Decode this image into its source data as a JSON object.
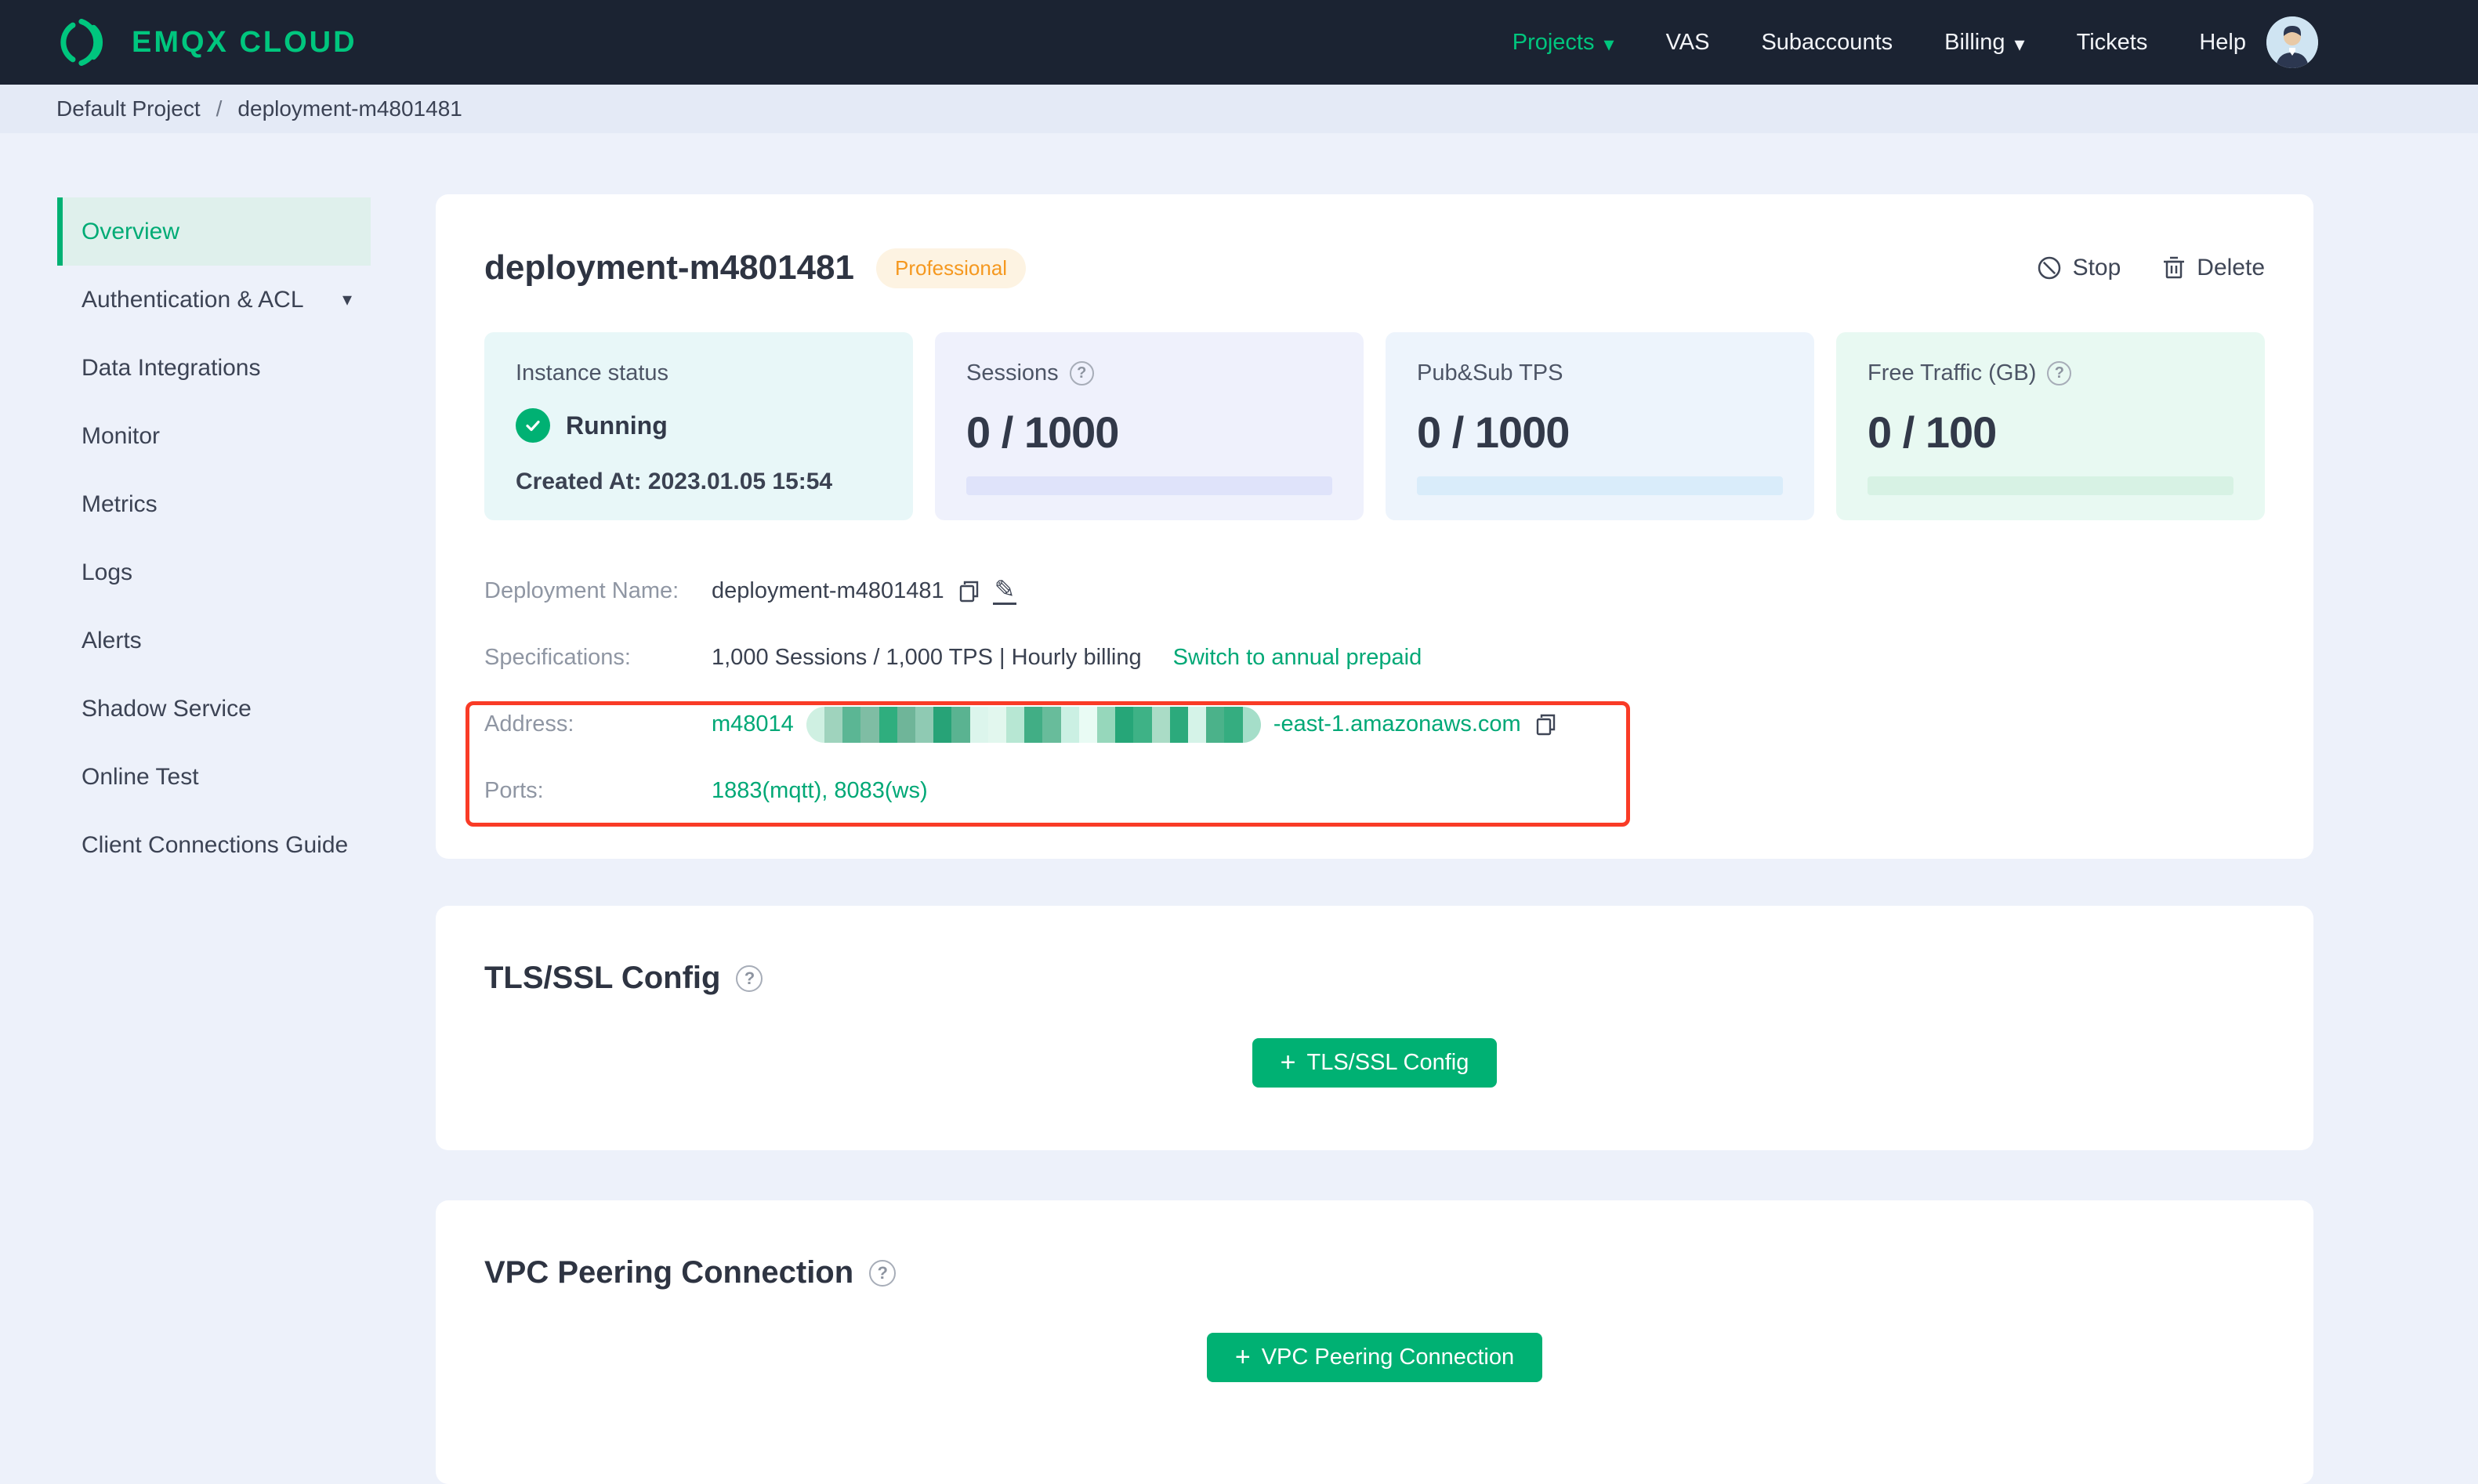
{
  "colors": {
    "accent_green": "#00b173",
    "link_green": "#00a876",
    "navbar_bg": "#1b2332",
    "badge_bg": "#fdf3e2",
    "badge_text": "#f5981f",
    "annotation_red": "#f93b26",
    "status_card_bg": "#e8f7f8",
    "sessions_card_bg": "#eff1fc",
    "tps_card_bg": "#edf4fc",
    "traffic_card_bg": "#e8f9f2"
  },
  "navbar": {
    "brand": "EMQX CLOUD",
    "items": [
      {
        "label": "Projects",
        "active": true,
        "caret": true
      },
      {
        "label": "VAS"
      },
      {
        "label": "Subaccounts"
      },
      {
        "label": "Billing",
        "caret": true
      },
      {
        "label": "Tickets"
      },
      {
        "label": "Help"
      }
    ]
  },
  "breadcrumb": {
    "project": "Default Project",
    "separator": "/",
    "deployment": "deployment-m4801481"
  },
  "sidebar": {
    "items": [
      {
        "label": "Overview",
        "active": true
      },
      {
        "label": "Authentication & ACL",
        "caret": true
      },
      {
        "label": "Data Integrations"
      },
      {
        "label": "Monitor"
      },
      {
        "label": "Metrics"
      },
      {
        "label": "Logs"
      },
      {
        "label": "Alerts"
      },
      {
        "label": "Shadow Service"
      },
      {
        "label": "Online Test"
      },
      {
        "label": "Client Connections Guide"
      }
    ]
  },
  "overview": {
    "title": "deployment-m4801481",
    "badge": "Professional",
    "stop_label": "Stop",
    "delete_label": "Delete",
    "stats": {
      "instance": {
        "label": "Instance status",
        "status": "Running",
        "created": "Created At: 2023.01.05 15:54"
      },
      "sessions": {
        "label": "Sessions",
        "value": "0 / 1000"
      },
      "tps": {
        "label": "Pub&Sub TPS",
        "value": "0 / 1000"
      },
      "traffic": {
        "label": "Free Traffic (GB)",
        "value": "0 / 100"
      }
    },
    "fields": {
      "name": {
        "label": "Deployment Name:",
        "value": "deployment-m4801481"
      },
      "specs": {
        "label": "Specifications:",
        "value": "1,000 Sessions / 1,000 TPS | Hourly billing",
        "link": "Switch to annual prepaid"
      },
      "address": {
        "label": "Address:",
        "prefix": "m48014",
        "suffix": "-east-1.amazonaws.com",
        "masked": true
      },
      "ports": {
        "label": "Ports:",
        "value": "1883(mqtt), 8083(ws)"
      }
    }
  },
  "sections": {
    "tls": {
      "title": "TLS/SSL Config",
      "button_label": "TLS/SSL Config"
    },
    "vpc": {
      "title": "VPC Peering Connection",
      "button_label": "VPC Peering Connection"
    }
  },
  "mosaic_colors": [
    "#cff0e2",
    "#9fd3bd",
    "#5bb694",
    "#7fbda4",
    "#2fae7e",
    "#6fb599",
    "#8fcab3",
    "#27a377",
    "#5ab391",
    "#dcf5ec",
    "#e2f7ee",
    "#b7e7d3",
    "#41ae85",
    "#68bc9b",
    "#cbf0e3",
    "#e9fbf4",
    "#96d7bb",
    "#26a678",
    "#3eb286",
    "#aadcc6",
    "#2caa7c",
    "#d5f3e8",
    "#4bb28a",
    "#35ad80",
    "#a5dec9"
  ]
}
